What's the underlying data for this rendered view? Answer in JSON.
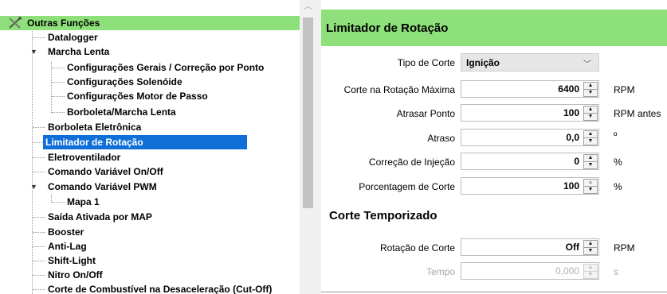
{
  "tree": {
    "root_label": "Outras Funções",
    "items": [
      {
        "label": "Datalogger"
      },
      {
        "label": "Marcha Lenta"
      },
      {
        "label": "Configurações Gerais / Correção por Ponto"
      },
      {
        "label": "Configurações Solenóide"
      },
      {
        "label": "Configurações Motor de Passo"
      },
      {
        "label": "Borboleta/Marcha Lenta"
      },
      {
        "label": "Borboleta Eletrônica"
      },
      {
        "label": "Limitador de Rotação"
      },
      {
        "label": "Eletroventilador"
      },
      {
        "label": "Comando Variável On/Off"
      },
      {
        "label": "Comando Variável PWM"
      },
      {
        "label": "Mapa 1"
      },
      {
        "label": "Saída Ativada por MAP"
      },
      {
        "label": "Booster"
      },
      {
        "label": "Anti-Lag"
      },
      {
        "label": "Shift-Light"
      },
      {
        "label": "Nitro On/Off"
      },
      {
        "label": "Corte de Combustível na Desaceleração (Cut-Off)"
      }
    ]
  },
  "panel": {
    "title": "Limitador de Rotação",
    "tipo_corte": {
      "label": "Tipo de Corte",
      "value": "Ignição"
    },
    "fields": [
      {
        "label": "Corte na Rotação Máxima",
        "value": "6400",
        "unit": "RPM"
      },
      {
        "label": "Atrasar Ponto",
        "value": "100",
        "unit": "RPM antes"
      },
      {
        "label": "Atraso",
        "value": "0,0",
        "unit": "º"
      },
      {
        "label": "Correção de Injeção",
        "value": "0",
        "unit": "%"
      },
      {
        "label": "Porcentagem de Corte",
        "value": "100",
        "unit": "%"
      }
    ],
    "section_title": "Corte Temporizado",
    "timed": [
      {
        "label": "Rotação de Corte",
        "value": "Off",
        "unit": "RPM"
      },
      {
        "label": "Tempo",
        "value": "0,000",
        "unit": "s"
      }
    ]
  },
  "colors": {
    "header_green": "#8ee07a",
    "selection_blue": "#0f6fd6"
  }
}
